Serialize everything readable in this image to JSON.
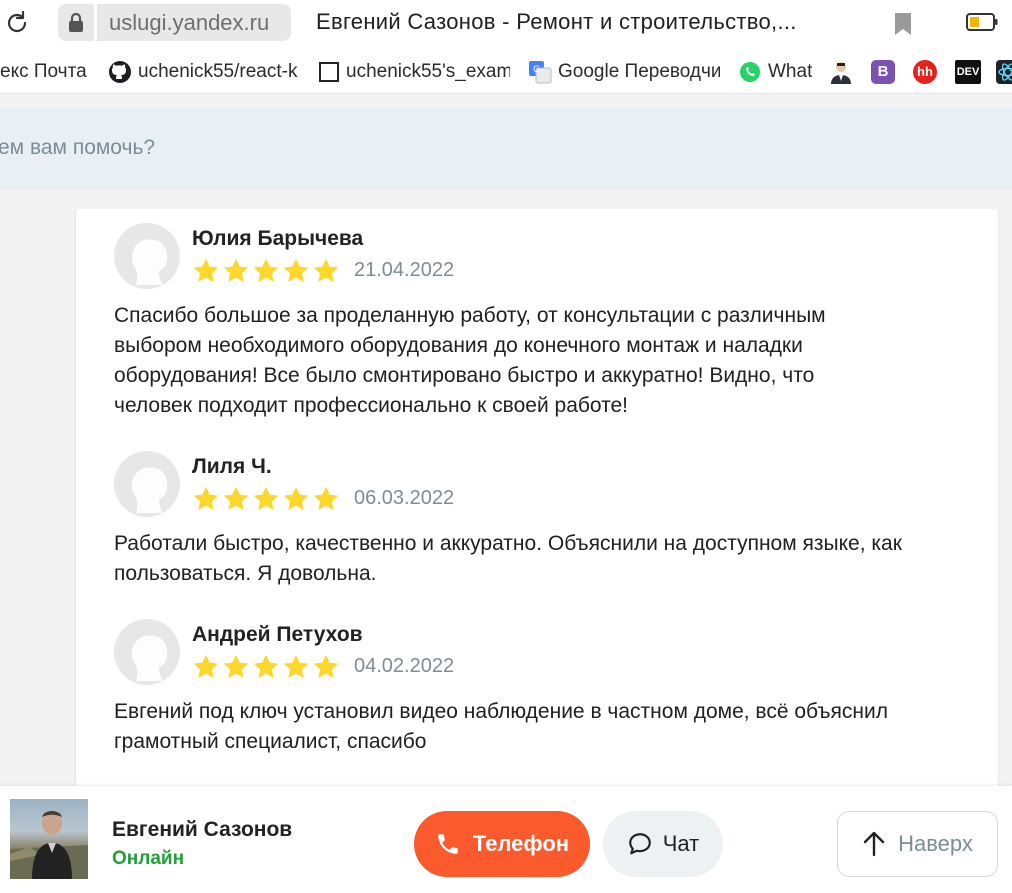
{
  "browser": {
    "url": "uslugi.yandex.ru",
    "tab_title": "Евгений Сазонов - Ремонт и строительство,...",
    "bookmarks": [
      {
        "label": "екс Почта",
        "icon": "none"
      },
      {
        "label": "uchenick55/react-k",
        "icon": "github-icon"
      },
      {
        "label": "uchenick55's_exam",
        "icon": "square-icon"
      },
      {
        "label": "Google Переводчик",
        "icon": "google-translate-icon"
      },
      {
        "label": "What",
        "icon": "whatsapp-icon"
      }
    ],
    "bookmark_icons": [
      "person-icon",
      "bootstrap-icon",
      "hh-icon",
      "dev-icon",
      "react-icon"
    ],
    "hh_label": "hh",
    "dev_label": "DEV",
    "b_label": "B"
  },
  "search": {
    "placeholder": "ем вам помочь?"
  },
  "reviews": [
    {
      "author": "Юлия Барычева",
      "rating": 5,
      "date": "21.04.2022",
      "text_lines": [
        "Спасибо большое за проделанную работу, от консультации с различным",
        "выбором необходимого оборудования до конечного монтаж и наладки",
        "оборудования! Все было смонтировано быстро и аккуратно! Видно, что",
        "человек подходит профессионально к своей работе!"
      ]
    },
    {
      "author": "Лиля Ч.",
      "rating": 5,
      "date": "06.03.2022",
      "text_lines": [
        "Работали быстро, качественно и аккуратно. Объяснили на доступном языке, как",
        "пользоваться. Я довольна."
      ]
    },
    {
      "author": "Андрей Петухов",
      "rating": 5,
      "date": "04.02.2022",
      "text_lines": [
        "Евгений под ключ установил видео наблюдение в частном доме, всё объяснил",
        "грамотный специалист, спасибо"
      ]
    }
  ],
  "bottom_bar": {
    "name": "Евгений Сазонов",
    "status": "Онлайн",
    "phone_label": "Телефон",
    "chat_label": "Чат",
    "up_label": "Наверх"
  },
  "colors": {
    "accent_orange": "#fb5a2c",
    "online_green": "#21a038",
    "star_yellow": "#fcd82c",
    "search_band": "#e9f0f3"
  }
}
